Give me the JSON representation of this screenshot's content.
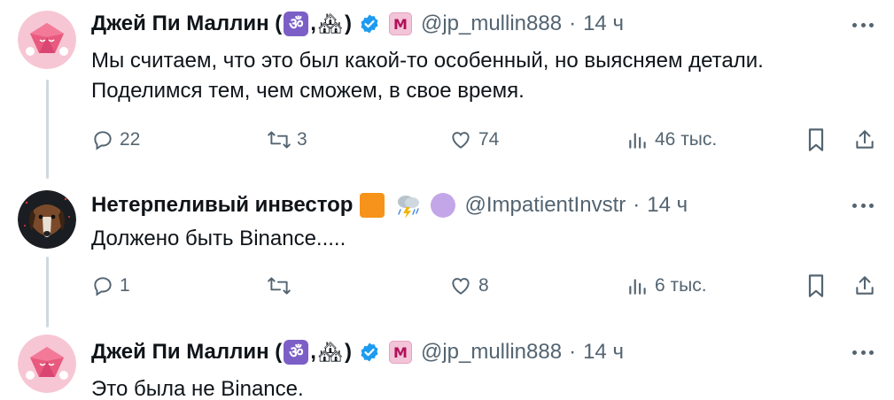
{
  "tweets": [
    {
      "author": {
        "name": "Джей Пи Маллин (",
        "comma": ",",
        "close_paren": ")",
        "emoji_1": "ॐ",
        "emoji_2": "🏘",
        "affiliate_badge": "M",
        "handle": "@jp_mullin888"
      },
      "dot": "·",
      "time": "14 ч",
      "text": "Мы считаем, что это был какой-то особенный, но выясняем детали.\nПоделимся тем, чем сможем, в свое время.",
      "stats": {
        "replies": "22",
        "retweets": "3",
        "likes": "74",
        "views": "46 тыс."
      }
    },
    {
      "author": {
        "name": "Нетерпеливый инвестор",
        "handle": "@ImpatientInvstr"
      },
      "dot": "·",
      "time": "14 ч",
      "text": "Должено быть Binance.....",
      "stats": {
        "replies": "1",
        "retweets": "",
        "likes": "8",
        "views": "6 тыс."
      }
    },
    {
      "author": {
        "name": "Джей Пи Маллин (",
        "comma": ",",
        "close_paren": ")",
        "emoji_1": "ॐ",
        "emoji_2": "🏘",
        "affiliate_badge": "M",
        "handle": "@jp_mullin888"
      },
      "dot": "·",
      "time": "14 ч",
      "text": "Это была не Binance."
    }
  ],
  "colors": {
    "text_primary": "#0f1419",
    "text_secondary": "#536471",
    "verified_blue": "#1d9bf0",
    "thread_line": "#cfd9de",
    "bitcoin_orange": "#f7931a",
    "purple_circle": "#c3a6e8"
  },
  "icons": [
    "reply-icon",
    "retweet-icon",
    "like-icon",
    "views-icon",
    "bookmark-icon",
    "share-icon",
    "more-icon",
    "verified-icon"
  ]
}
